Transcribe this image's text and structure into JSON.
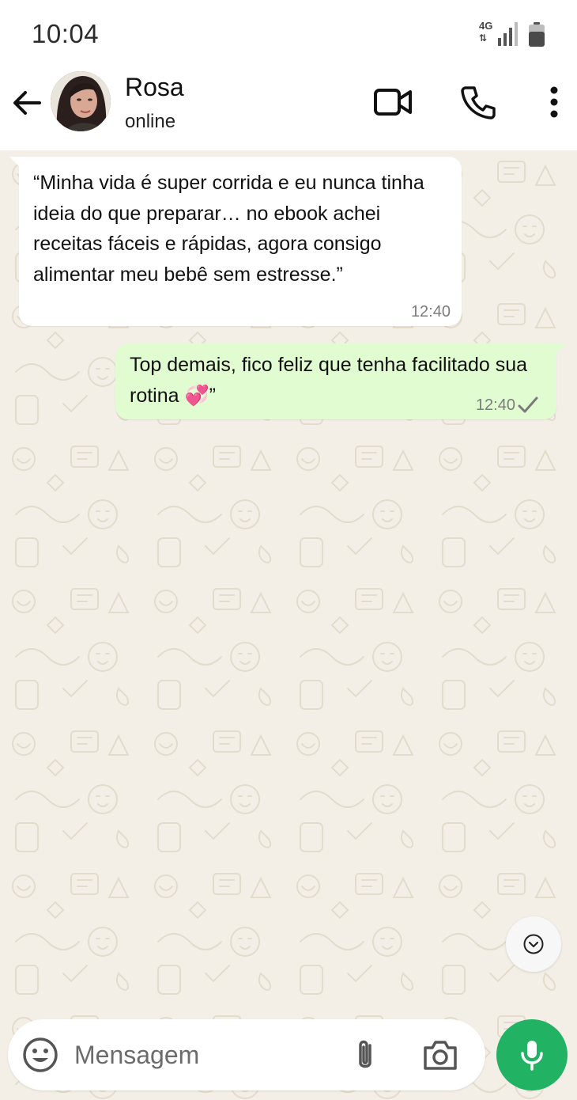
{
  "status_bar": {
    "time": "10:04",
    "network": "4G",
    "icons": [
      "network-4g-icon",
      "signal-icon",
      "battery-icon"
    ]
  },
  "header": {
    "contact_name": "Rosa",
    "contact_status": "online",
    "icons": [
      "back-arrow-icon",
      "video-call-icon",
      "phone-icon",
      "more-options-icon"
    ]
  },
  "messages": [
    {
      "direction": "incoming",
      "text": "“Minha vida é super corrida e eu nunca tinha ideia do que preparar… no ebook achei receitas fáceis e rápidas, agora consigo alimentar meu bebê sem estresse.”",
      "time": "12:40"
    },
    {
      "direction": "outgoing",
      "text": "Top demais, fico feliz que tenha facilitado sua rotina 💞”",
      "time": "12:40",
      "status": "sent"
    }
  ],
  "composer": {
    "placeholder": "Mensagem",
    "icons": [
      "emoji-icon",
      "attach-icon",
      "camera-icon",
      "mic-icon"
    ]
  },
  "colors": {
    "incoming_bubble": "#ffffff",
    "outgoing_bubble": "#e2fcd2",
    "chat_background": "#f3efe6",
    "mic_button": "#21b264"
  }
}
